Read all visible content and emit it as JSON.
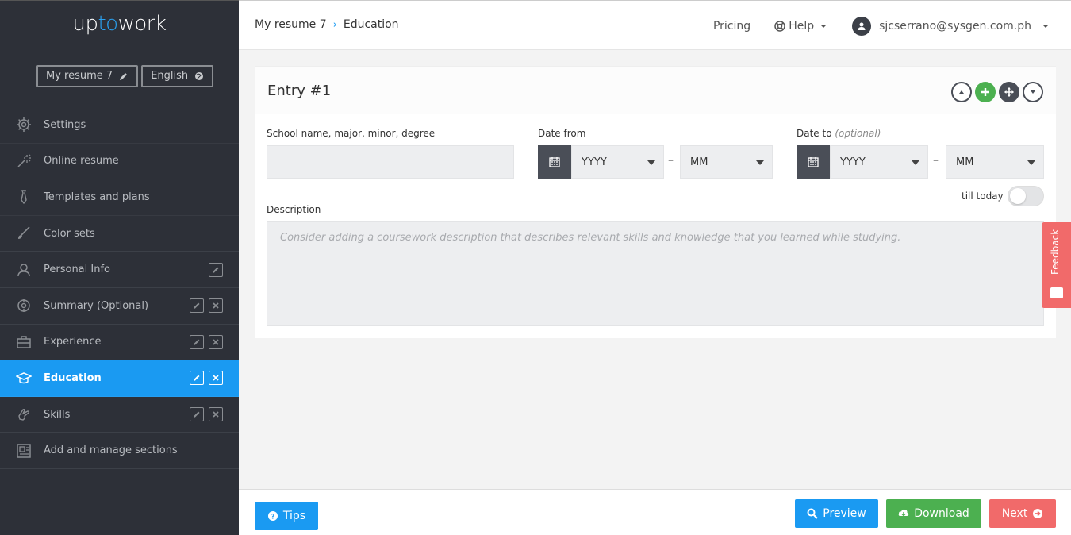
{
  "app": {
    "logo_a": "up",
    "logo_b": "to",
    "logo_c": "work"
  },
  "sidebar": {
    "resume_name": "My resume 7",
    "language": "English",
    "items": [
      {
        "label": "Settings",
        "icon": "gear-icon"
      },
      {
        "label": "Online resume",
        "icon": "magic-wand-icon"
      },
      {
        "label": "Templates and plans",
        "icon": "tie-icon"
      },
      {
        "label": "Color sets",
        "icon": "brush-icon"
      },
      {
        "label": "Personal Info",
        "icon": "user-icon"
      },
      {
        "label": "Summary (Optional)",
        "icon": "crosshair-icon"
      },
      {
        "label": "Experience",
        "icon": "briefcase-icon"
      },
      {
        "label": "Education",
        "icon": "graduation-cap-icon"
      },
      {
        "label": "Skills",
        "icon": "hand-icon"
      },
      {
        "label": "Add and manage sections",
        "icon": "sections-icon"
      }
    ]
  },
  "header": {
    "breadcrumb_root": "My resume 7",
    "breadcrumb_current": "Education",
    "pricing": "Pricing",
    "help": "Help",
    "user_email": "sjcserrano@sysgen.com.ph"
  },
  "entry": {
    "title": "Entry #1",
    "school_label": "School name, major, minor, degree",
    "school_value": "",
    "date_from_label": "Date from",
    "date_to_label": "Date to",
    "date_to_optional": "(optional)",
    "year_placeholder": "YYYY",
    "month_placeholder": "MM",
    "dash": "–",
    "till_today": "till today",
    "till_today_on": false,
    "description_label": "Description",
    "description_placeholder": "Consider adding a coursework description that describes relevant skills and knowledge that you learned while studying."
  },
  "feedback": {
    "label": "Feedback"
  },
  "footer": {
    "tips": "Tips",
    "preview": "Preview",
    "download": "Download",
    "next": "Next"
  },
  "colors": {
    "sidebar_bg": "#2d3038",
    "accent": "#1a9af2",
    "green": "#4cb050",
    "red": "#f16a6a"
  }
}
